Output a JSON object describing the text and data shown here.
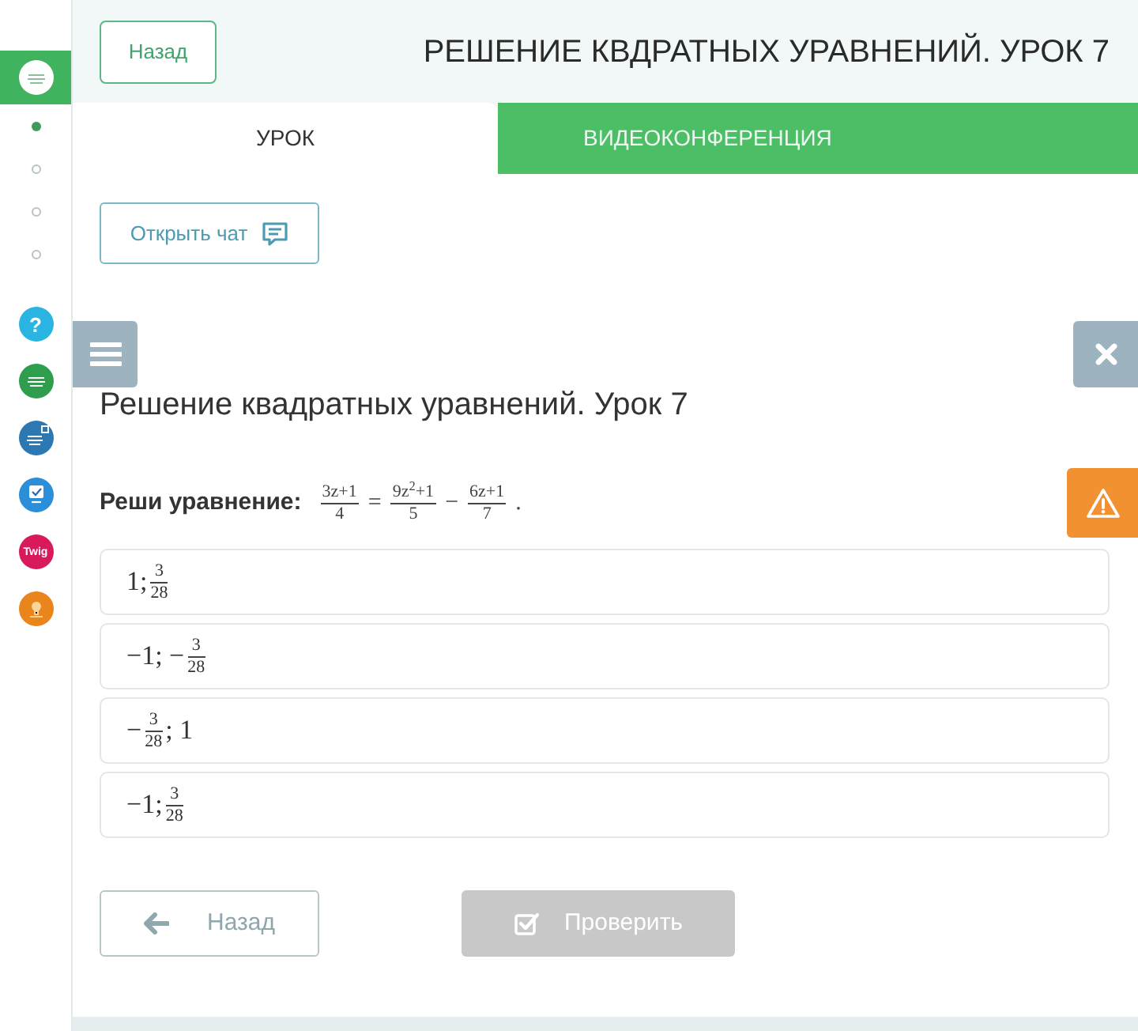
{
  "sidebar": {
    "steps": [
      {
        "selected": true
      },
      {
        "selected": false
      },
      {
        "selected": false
      },
      {
        "selected": false
      }
    ],
    "apps": [
      {
        "kind": "help",
        "label": "?",
        "color": "#29b4e2"
      },
      {
        "kind": "lines",
        "color": "#2f9e4c"
      },
      {
        "kind": "board",
        "color": "#2c78b3"
      },
      {
        "kind": "check",
        "color": "#2a8fd8"
      },
      {
        "kind": "text",
        "label": "Twig",
        "color": "#d8195c"
      },
      {
        "kind": "bulb",
        "color": "#e9851b"
      }
    ]
  },
  "header": {
    "back_button": "Назад",
    "title": "РЕШЕНИЕ КВДРАТНЫХ УРАВНЕНИЙ. УРОК 7"
  },
  "tabs": [
    {
      "label": "УРОК",
      "selected": true
    },
    {
      "label": "ВИДЕОКОНФЕРЕНЦИЯ",
      "selected": false
    }
  ],
  "chat_button": "Открыть чат",
  "lesson_title": "Решение квадратных уравнений. Урок 7",
  "question": {
    "label": "Реши уравнение:",
    "formula": [
      {
        "kind": "frac",
        "num": "3z+1",
        "den": "4"
      },
      {
        "kind": "text",
        "text": "="
      },
      {
        "kind": "frac",
        "num": "9z$^{2}$+1",
        "den": "5"
      },
      {
        "kind": "text",
        "text": "−"
      },
      {
        "kind": "frac",
        "num": "6z+1",
        "den": "7"
      },
      {
        "kind": "text",
        "text": "."
      }
    ]
  },
  "options": [
    {
      "selected": false,
      "parts": [
        {
          "kind": "text",
          "text": "1;"
        },
        {
          "kind": "frac",
          "num": "3",
          "den": "28"
        }
      ]
    },
    {
      "selected": false,
      "parts": [
        {
          "kind": "text",
          "text": "−1; −"
        },
        {
          "kind": "frac",
          "num": "3",
          "den": "28"
        }
      ]
    },
    {
      "selected": false,
      "parts": [
        {
          "kind": "text",
          "text": "−"
        },
        {
          "kind": "frac",
          "num": "3",
          "den": "28"
        },
        {
          "kind": "text",
          "text": "; 1"
        }
      ]
    },
    {
      "selected": false,
      "parts": [
        {
          "kind": "text",
          "text": "−1;"
        },
        {
          "kind": "frac",
          "num": "3",
          "den": "28"
        }
      ]
    }
  ],
  "buttons": [
    {
      "kind": "back",
      "label": "Назад",
      "disabled": false
    },
    {
      "kind": "check",
      "label": "Проверить",
      "disabled": true
    }
  ]
}
